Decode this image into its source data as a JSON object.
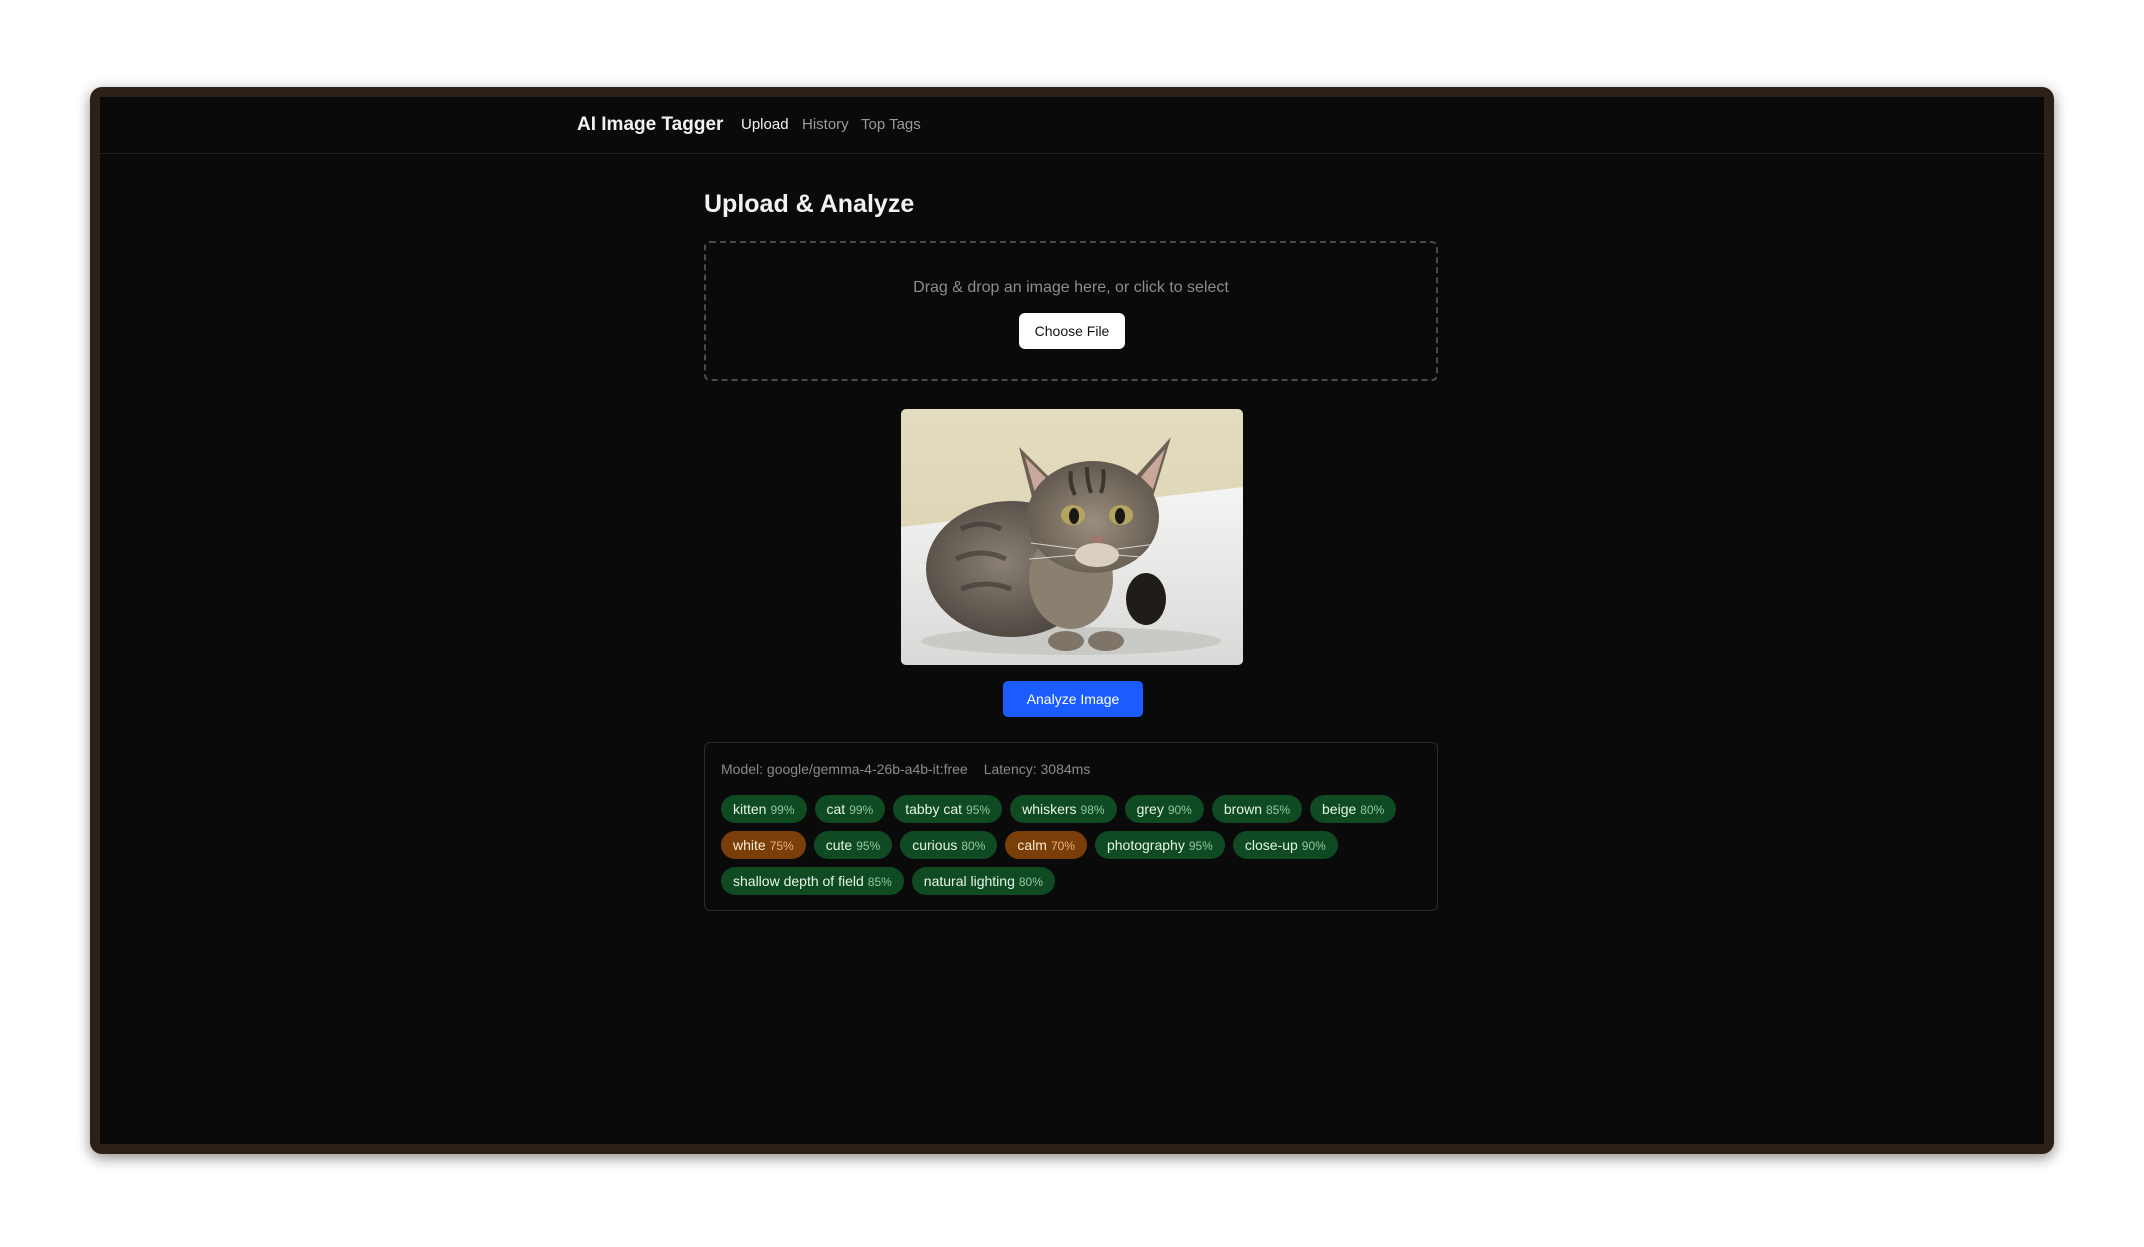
{
  "app": {
    "title": "AI Image Tagger"
  },
  "nav": {
    "items": [
      {
        "label": "Upload",
        "active": true
      },
      {
        "label": "History",
        "active": false
      },
      {
        "label": "Top Tags",
        "active": false
      }
    ]
  },
  "page": {
    "title": "Upload & Analyze"
  },
  "dropzone": {
    "text": "Drag & drop an image here, or click to select",
    "button_label": "Choose File"
  },
  "preview": {
    "subject": "tabby kitten photo"
  },
  "analyze": {
    "button_label": "Analyze Image"
  },
  "results": {
    "model": "Model: google/gemma-4-26b-a4b-it:free",
    "latency": "Latency: 3084ms",
    "tags": [
      [
        {
          "label": "kitten",
          "confidence": "99%",
          "tone": "green"
        },
        {
          "label": "cat",
          "confidence": "99%",
          "tone": "green"
        },
        {
          "label": "tabby cat",
          "confidence": "95%",
          "tone": "green"
        },
        {
          "label": "whiskers",
          "confidence": "98%",
          "tone": "green"
        },
        {
          "label": "grey",
          "confidence": "90%",
          "tone": "green"
        },
        {
          "label": "brown",
          "confidence": "85%",
          "tone": "green"
        },
        {
          "label": "beige",
          "confidence": "80%",
          "tone": "green"
        }
      ],
      [
        {
          "label": "white",
          "confidence": "75%",
          "tone": "orange"
        },
        {
          "label": "cute",
          "confidence": "95%",
          "tone": "green"
        },
        {
          "label": "curious",
          "confidence": "80%",
          "tone": "green"
        },
        {
          "label": "calm",
          "confidence": "70%",
          "tone": "orange"
        },
        {
          "label": "photography",
          "confidence": "95%",
          "tone": "green"
        },
        {
          "label": "close-up",
          "confidence": "90%",
          "tone": "green"
        }
      ],
      [
        {
          "label": "shallow depth of field",
          "confidence": "85%",
          "tone": "green"
        },
        {
          "label": "natural lighting",
          "confidence": "80%",
          "tone": "green"
        }
      ]
    ]
  },
  "colors": {
    "background": "#0a0a0a",
    "frame": "#2c2119",
    "accent": "#1a5cff",
    "tag_high": "#0f4a23",
    "tag_medium": "#7a3e08"
  }
}
